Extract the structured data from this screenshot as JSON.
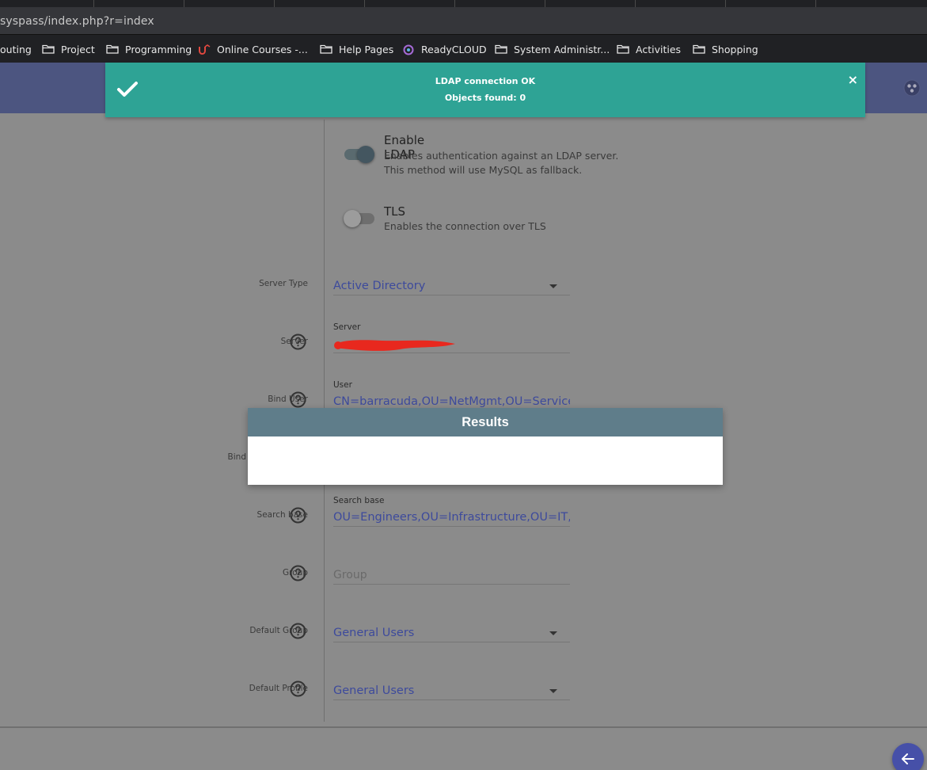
{
  "browser": {
    "url": "syspass/index.php?r=index",
    "bookmarks": [
      {
        "label": "outing",
        "icon": "none"
      },
      {
        "label": "Project",
        "icon": "folder-icon"
      },
      {
        "label": "Programming",
        "icon": "folder-icon"
      },
      {
        "label": "Online Courses -...",
        "icon": "udemy-icon"
      },
      {
        "label": "Help Pages",
        "icon": "folder-icon"
      },
      {
        "label": "ReadyCLOUD",
        "icon": "readycloud-icon"
      },
      {
        "label": "System Administr...",
        "icon": "folder-icon"
      },
      {
        "label": "Activities",
        "icon": "folder-icon"
      },
      {
        "label": "Shopping",
        "icon": "folder-icon"
      }
    ]
  },
  "notification": {
    "line1": "LDAP connection OK",
    "line2": "Objects found: 0",
    "close": "×",
    "color": "#2ea395"
  },
  "ldap": {
    "enable": {
      "title": "Enable LDAP",
      "desc1": "Enables authentication against an LDAP server.",
      "desc2": "This method will use MySQL as fallback.",
      "on": true
    },
    "tls": {
      "title": "TLS",
      "desc": "Enables the connection over TLS",
      "on": false
    }
  },
  "form": {
    "server_type": {
      "label": "Server Type",
      "value": "Active Directory"
    },
    "server": {
      "label": "Server",
      "float": "Server"
    },
    "bind_user": {
      "label": "Bind User",
      "float": "User",
      "value": "CN=barracuda,OU=NetMgmt,OU=Service"
    },
    "bind_pass": {
      "label": "Bind"
    },
    "search_base": {
      "label": "Search base",
      "float": "Search base",
      "value": "OU=Engineers,OU=Infrastructure,OU=IT,OU"
    },
    "group": {
      "label": "Group",
      "placeholder": "Group"
    },
    "default_group": {
      "label": "Default Group",
      "value": "General Users"
    },
    "default_profile": {
      "label": "Default Profile",
      "value": "General Users"
    }
  },
  "dialog": {
    "title": "Results"
  },
  "colors": {
    "header": "#4c5580",
    "accent": "#3d4a9c",
    "dialog_header": "#5f7d8a"
  }
}
